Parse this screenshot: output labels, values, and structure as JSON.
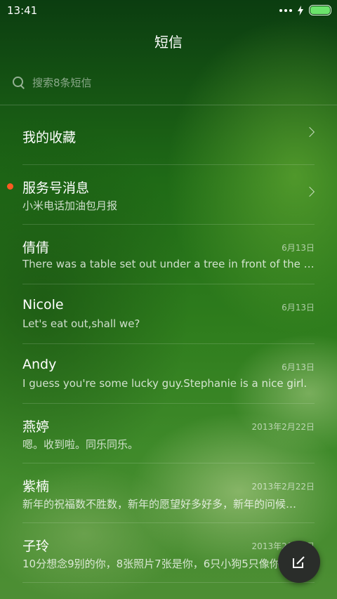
{
  "status_bar": {
    "time": "13:41",
    "icons": [
      "more-dots-icon",
      "charging-bolt-icon",
      "battery-icon"
    ],
    "battery_color": "#6be36b"
  },
  "header": {
    "title": "短信"
  },
  "search": {
    "placeholder": "搜索8条短信"
  },
  "conversations": [
    {
      "name": "我的收藏",
      "preview": "",
      "date": "",
      "chevron": true,
      "unread": false
    },
    {
      "name": "服务号消息",
      "preview": "小米电话加油包月报",
      "date": "",
      "chevron": true,
      "unread": true
    },
    {
      "name": "倩倩",
      "preview": "There was a table set out under a tree in front of the ho…",
      "date": "6月13日",
      "chevron": false,
      "unread": false
    },
    {
      "name": "Nicole",
      "preview": "Let's eat out,shall we?",
      "date": "6月13日",
      "chevron": false,
      "unread": false
    },
    {
      "name": "Andy",
      "preview": "I guess you're some lucky guy.Stephanie is a nice girl.",
      "date": "6月13日",
      "chevron": false,
      "unread": false
    },
    {
      "name": "燕婷",
      "preview": "嗯。收到啦。同乐同乐。",
      "date": "2013年2月22日",
      "chevron": false,
      "unread": false
    },
    {
      "name": "紫楠",
      "preview": "新年的祝福数不胜数，新年的愿望好多好多，新年的问候…",
      "date": "2013年2月22日",
      "chevron": false,
      "unread": false
    },
    {
      "name": "子玲",
      "preview": "10分想念9别的你，8张照片7张是你，6只小狗5只像你…",
      "date": "2013年2月22日",
      "chevron": false,
      "unread": false
    }
  ],
  "fab": {
    "icon": "compose-icon"
  },
  "colors": {
    "unread_dot": "#ff5a22",
    "fab_background": "#2a2d2a"
  }
}
